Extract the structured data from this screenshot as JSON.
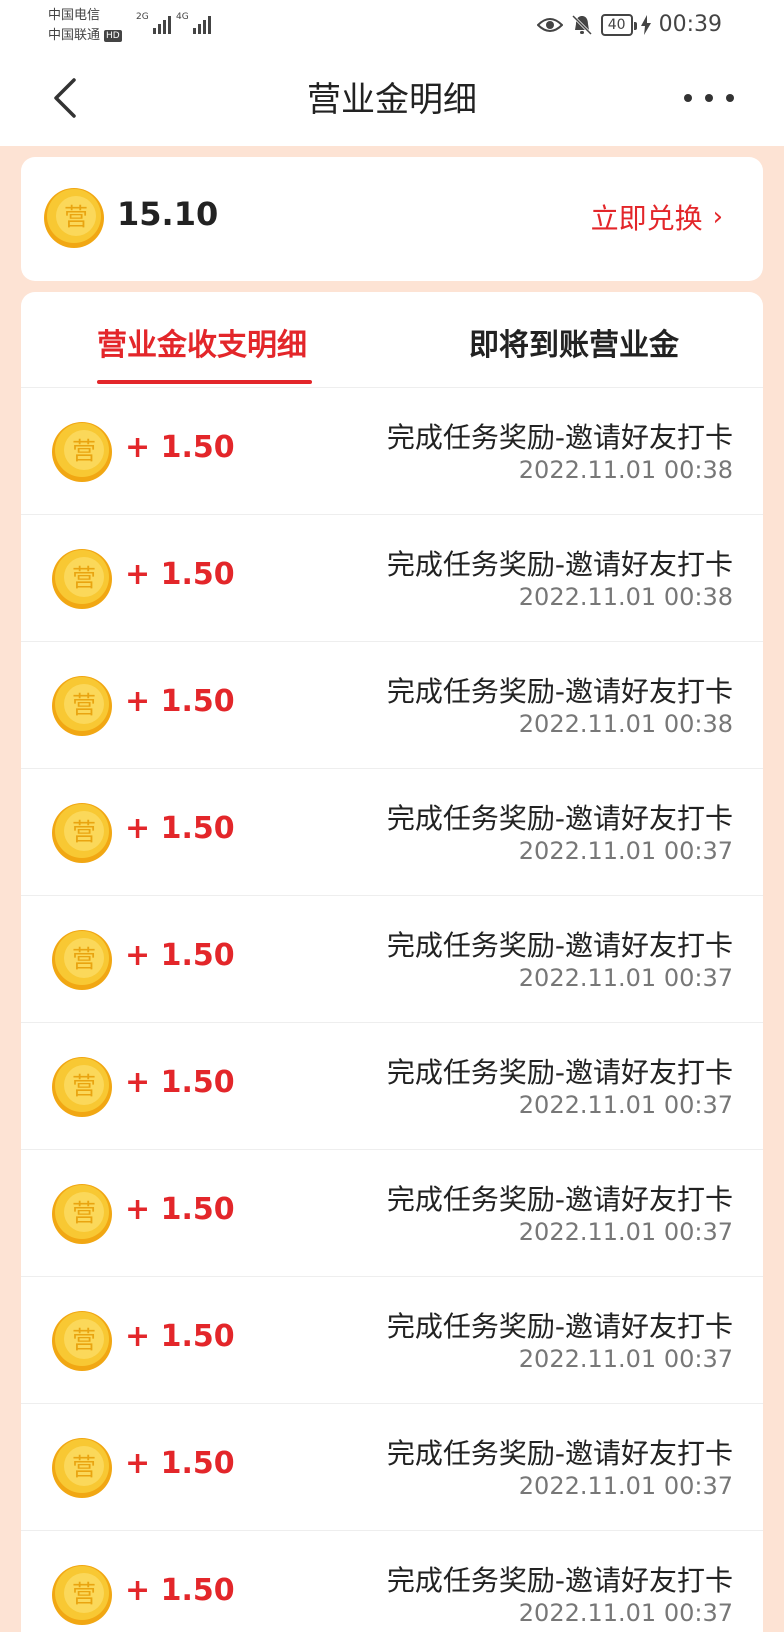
{
  "status": {
    "carrier1": "中国电信",
    "carrier2": "中国联通",
    "hd": "HD",
    "net1": "2G",
    "net2": "4G",
    "battery": "40",
    "time": "00:39"
  },
  "nav": {
    "title": "营业金明细"
  },
  "balance": {
    "value": "15.10",
    "exchange_label": "立即兑换",
    "exchange_chevron": "›"
  },
  "tabs": [
    {
      "label": "营业金收支明细"
    },
    {
      "label": "即将到账营业金"
    }
  ],
  "coin_glyph": "营",
  "records": [
    {
      "amount": "+ 1.50",
      "desc": "完成任务奖励-邀请好友打卡",
      "time": "2022.11.01 00:38"
    },
    {
      "amount": "+ 1.50",
      "desc": "完成任务奖励-邀请好友打卡",
      "time": "2022.11.01 00:38"
    },
    {
      "amount": "+ 1.50",
      "desc": "完成任务奖励-邀请好友打卡",
      "time": "2022.11.01 00:38"
    },
    {
      "amount": "+ 1.50",
      "desc": "完成任务奖励-邀请好友打卡",
      "time": "2022.11.01 00:37"
    },
    {
      "amount": "+ 1.50",
      "desc": "完成任务奖励-邀请好友打卡",
      "time": "2022.11.01 00:37"
    },
    {
      "amount": "+ 1.50",
      "desc": "完成任务奖励-邀请好友打卡",
      "time": "2022.11.01 00:37"
    },
    {
      "amount": "+ 1.50",
      "desc": "完成任务奖励-邀请好友打卡",
      "time": "2022.11.01 00:37"
    },
    {
      "amount": "+ 1.50",
      "desc": "完成任务奖励-邀请好友打卡",
      "time": "2022.11.01 00:37"
    },
    {
      "amount": "+ 1.50",
      "desc": "完成任务奖励-邀请好友打卡",
      "time": "2022.11.01 00:37"
    },
    {
      "amount": "+ 1.50",
      "desc": "完成任务奖励-邀请好友打卡",
      "time": "2022.11.01 00:37"
    }
  ],
  "colors": {
    "accent": "#e3262a",
    "page_bg": "#fde3d4",
    "coin": "#f5b81e"
  }
}
